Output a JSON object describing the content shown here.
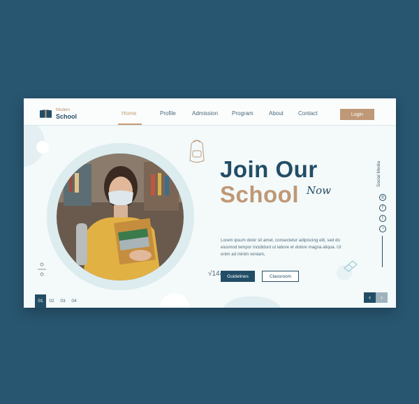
{
  "brand": {
    "top": "Modern",
    "bottom": "School"
  },
  "nav": {
    "home": "Home",
    "profile": "Profile",
    "admission": "Admission",
    "program": "Program",
    "about": "About",
    "contact": "Contact",
    "login": "Login"
  },
  "hero": {
    "line1": "Join Our",
    "line2": "School",
    "script": "Now",
    "paragraph": "Lorem ipsum dolor sit amet, consectetur adipiscing elit, sed do eiusmod tempor incididunt ut labore et dolore magna aliqua. Ut enim ad minim veniam,",
    "btn_guidelines": "Guidelines",
    "btn_classroom": "Classroom"
  },
  "social": {
    "label": "Social Media",
    "icons": [
      "instagram-icon",
      "facebook-icon",
      "twitter-icon",
      "whatsapp-icon"
    ]
  },
  "pagination": {
    "pages": [
      "01",
      "02",
      "03",
      "04"
    ],
    "active": "01"
  },
  "decoration": {
    "math": "√144"
  },
  "colors": {
    "background": "#285670",
    "navy": "#224d66",
    "tan": "#bf9877",
    "card": "#f4f9f9"
  }
}
